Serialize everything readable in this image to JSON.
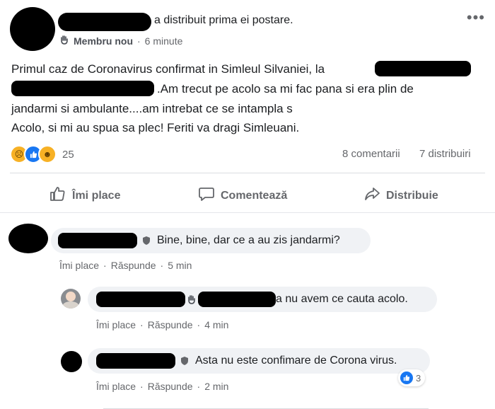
{
  "post": {
    "header_suffix": "a distribuit prima ei postare.",
    "member_badge": "Membru nou",
    "time": "6 minute",
    "text_line1": "Primul caz de Coronavirus confirmat in Simleul Silvaniei, la",
    "text_line2": ".Am trecut pe acolo sa mi fac pana si era plin de",
    "text_line3": "jandarmi si ambulante....am intrebat ce se intampla s",
    "text_line4": "Acolo, si mi au spua sa plec! Feriti va dragi Simleuani.",
    "reaction_count": "25",
    "comments_count": "8 comentarii",
    "shares_count": "7 distribuiri"
  },
  "actions": {
    "like": "Îmi place",
    "comment": "Comentează",
    "share": "Distribuie"
  },
  "comments": [
    {
      "text": "Bine, bine, dar ce a au zis jandarmi?",
      "like": "Îmi place",
      "reply": "Răspunde",
      "time": "5 min"
    },
    {
      "text": "a nu avem ce cauta acolo.",
      "like": "Îmi place",
      "reply": "Răspunde",
      "time": "4 min"
    },
    {
      "text": "Asta nu este confimare de Corona virus.",
      "like": "Îmi place",
      "reply": "Răspunde",
      "time": "2 min",
      "like_count": "3"
    }
  ],
  "colors": {
    "like_blue": "#1877f2",
    "haha_yellow": "#f7b125",
    "secondary_text": "#65676b"
  },
  "icons": {
    "more": "more-options-icon",
    "member": "hand-wave-icon",
    "like": "thumbs-up-icon",
    "comment": "speech-bubble-icon",
    "share": "share-arrow-icon",
    "shield": "shield-badge-icon"
  }
}
